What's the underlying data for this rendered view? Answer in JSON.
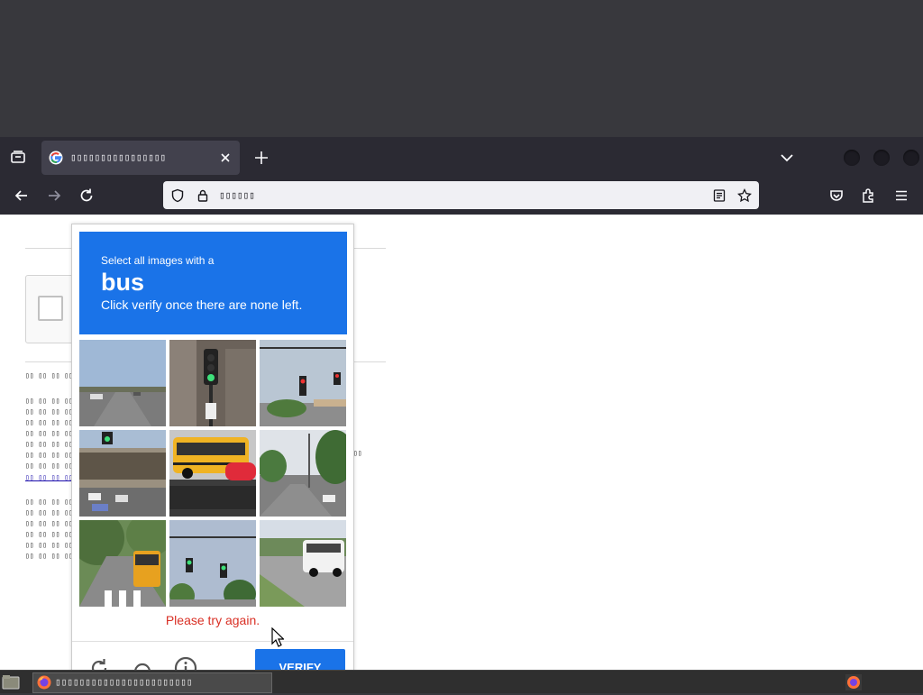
{
  "browser": {
    "tab_title": "▯▯▯▯▯▯▯▯▯▯▯▯▯▯▯▯",
    "url": "▯▯▯▯▯▯",
    "icons": [
      "tab-list-icon",
      "google-favicon",
      "close-tab-icon",
      "new-tab-icon",
      "list-all-tabs-icon",
      "back-icon",
      "forward-icon",
      "reload-icon",
      "shield-icon",
      "lock-icon",
      "reader-view-icon",
      "bookmark-star-icon",
      "pocket-icon",
      "extensions-icon",
      "menu-icon"
    ]
  },
  "page": {
    "garbled_text_1": "▯▯ ▯▯ ▯▯ ▯▯",
    "garbled_block": [
      "▯▯ ▯▯ ▯▯ ▯▯",
      "▯▯ ▯▯ ▯▯ ▯▯",
      "▯▯ ▯▯ ▯▯ ▯▯",
      "▯▯ ▯▯ ▯▯ ▯▯",
      "▯▯ ▯▯ ▯▯ ▯▯",
      "▯▯ ▯▯ ▯▯ ▯▯",
      "▯▯ ▯▯ ▯▯ ▯▯",
      "▯▯ ▯▯ ▯▯ ▯▯"
    ],
    "garbled_link": "▯▯ ▯▯ ▯▯ ▯▯",
    "garbled_side": "▯▯",
    "garbled_block_2": [
      "▯▯ ▯▯ ▯▯ ▯▯",
      "▯▯ ▯▯ ▯▯ ▯▯",
      "▯▯ ▯▯ ▯▯ ▯▯",
      "▯▯ ▯▯ ▯▯ ▯▯",
      "▯▯ ▯▯ ▯▯ ▯▯",
      "▯▯ ▯▯ ▯▯ ▯▯"
    ]
  },
  "captcha": {
    "instruction_small": "Select all images with a",
    "target": "bus",
    "instruction_sub": "Click verify once there are none left.",
    "error": "Please try again.",
    "verify_label": "VERIFY",
    "footer_icons": [
      "reload-icon",
      "audio-icon",
      "info-icon"
    ],
    "tiles": [
      {
        "name": "tile-road-1",
        "selected": false
      },
      {
        "name": "tile-traffic-light-building",
        "selected": false
      },
      {
        "name": "tile-traffic-lights-intersection",
        "selected": false
      },
      {
        "name": "tile-overpass-parking",
        "selected": false
      },
      {
        "name": "tile-school-bus",
        "selected": false
      },
      {
        "name": "tile-street-trees",
        "selected": false
      },
      {
        "name": "tile-bus-street",
        "selected": false
      },
      {
        "name": "tile-traffic-lights-palms",
        "selected": false
      },
      {
        "name": "tile-white-bus",
        "selected": false
      }
    ],
    "colors": {
      "header": "#1a73e8",
      "error": "#d93025",
      "verify": "#1a73e8"
    }
  },
  "taskbar": {
    "task_label": "▯▯▯▯▯▯▯▯▯▯▯▯▯▯▯▯▯▯▯▯▯▯▯"
  }
}
